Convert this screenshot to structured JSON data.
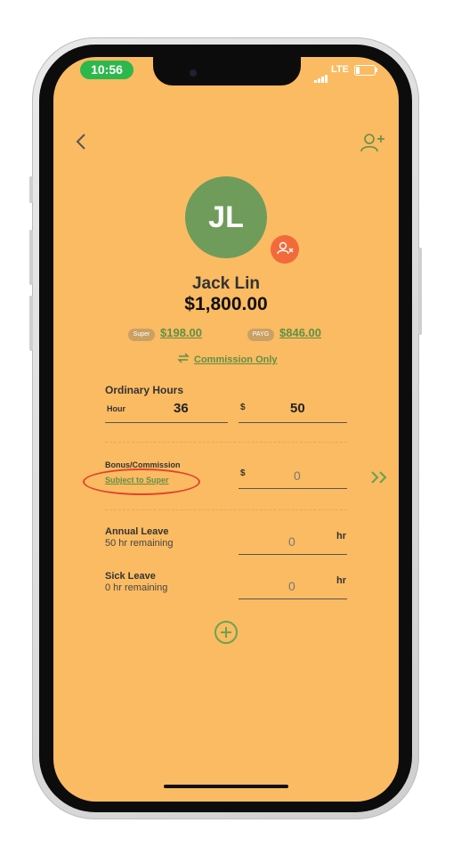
{
  "status_bar": {
    "time": "10:56",
    "network": "LTE"
  },
  "employee": {
    "initials": "JL",
    "name": "Jack Lin",
    "total": "$1,800.00",
    "super_chip": "Super",
    "super_amount": "$198.00",
    "payg_chip": "PAYG",
    "payg_amount": "$846.00",
    "pay_type": "Commission Only"
  },
  "ordinary_hours": {
    "title": "Ordinary Hours",
    "hour_label": "Hour",
    "hours": "36",
    "currency": "$",
    "rate": "50"
  },
  "bonus": {
    "title": "Bonus/Commission",
    "subject_link": "Subject to Super",
    "currency": "$",
    "value": "0"
  },
  "annual_leave": {
    "title": "Annual Leave",
    "remaining": "50 hr remaining",
    "value": "0",
    "unit": "hr"
  },
  "sick_leave": {
    "title": "Sick Leave",
    "remaining": "0 hr remaining",
    "value": "0",
    "unit": "hr"
  },
  "colors": {
    "screen_bg": "#fbbb63",
    "accent_green": "#6f9c5a",
    "badge_orange": "#f26a3a",
    "annotation_red": "#e0452d"
  },
  "icons": [
    "back-chevron-icon",
    "add-user-icon",
    "remove-user-icon",
    "swap-icon",
    "double-chevron-right-icon",
    "plus-circle-icon"
  ]
}
